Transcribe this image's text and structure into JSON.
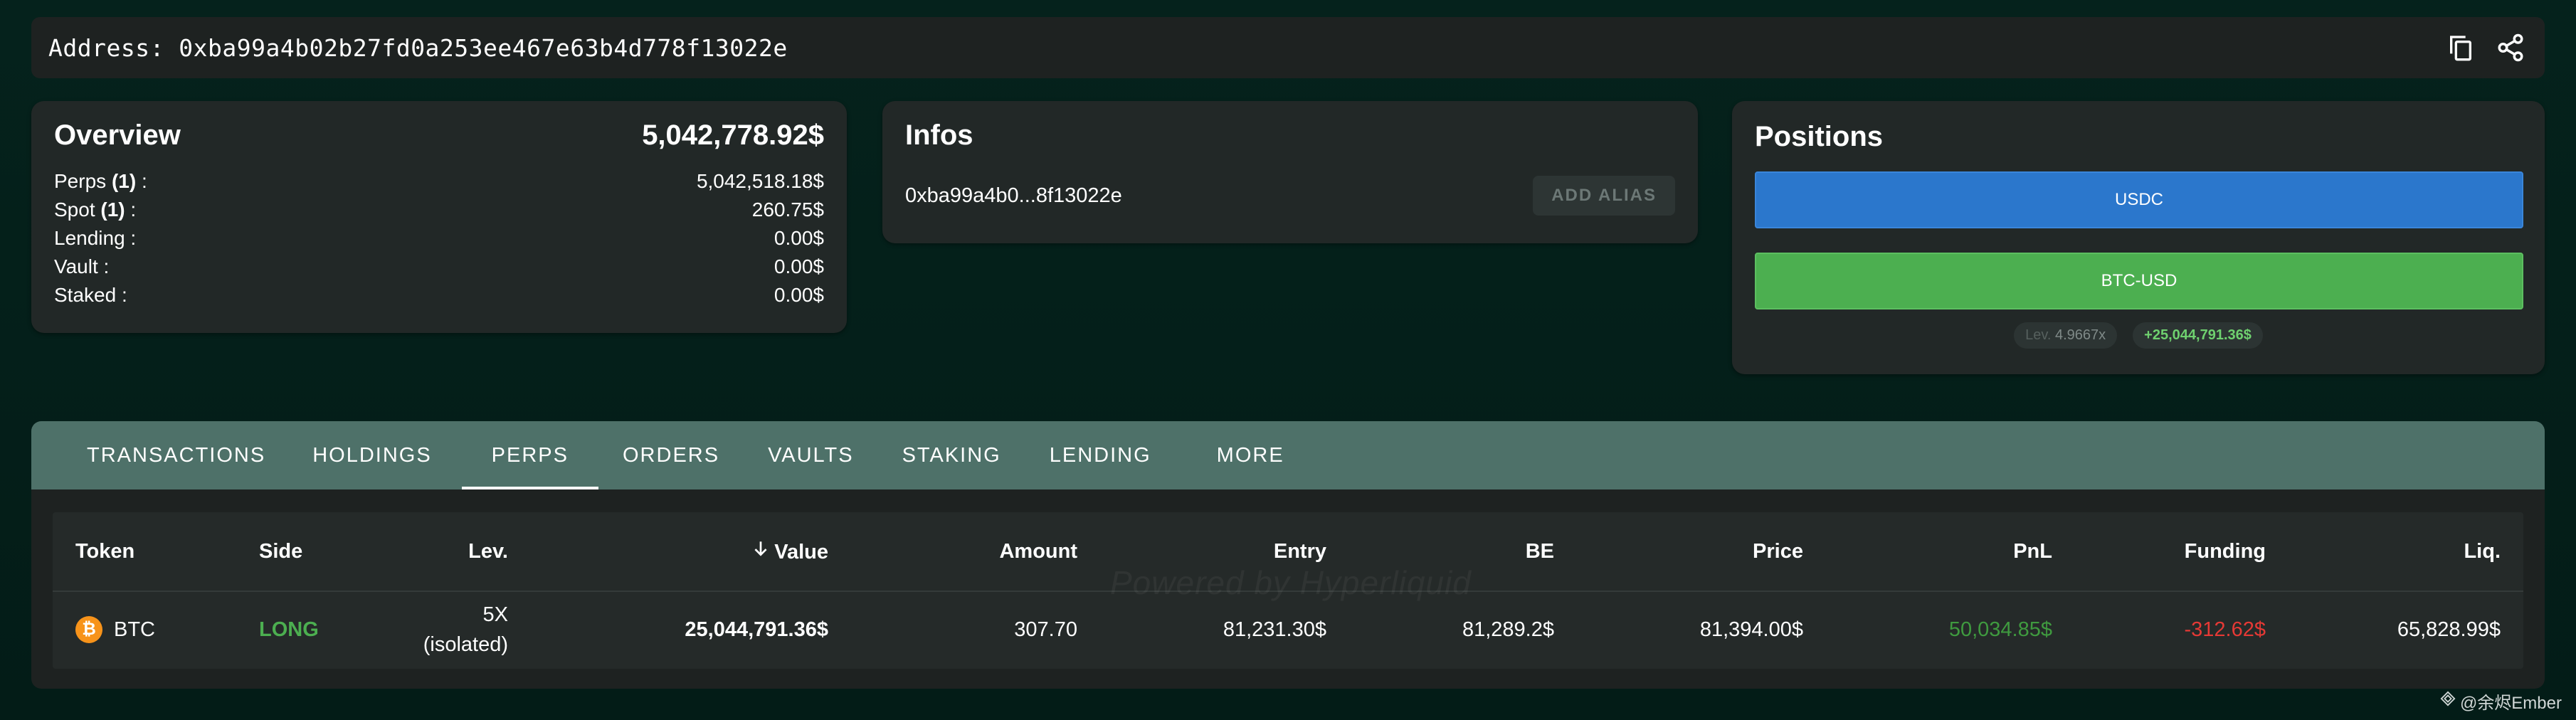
{
  "address_bar": {
    "label": "Address: 0xba99a4b02b27fd0a253ee467e63b4d778f13022e",
    "icons": [
      "copy-icon",
      "share-icon"
    ]
  },
  "overview": {
    "title": "Overview",
    "total": "5,042,778.92$",
    "rows": [
      {
        "label": "Perps",
        "count": "(1)",
        "suffix": " :",
        "value": "5,042,518.18$"
      },
      {
        "label": "Spot",
        "count": "(1)",
        "suffix": " :",
        "value": "260.75$"
      },
      {
        "label": "Lending :",
        "count": "",
        "suffix": "",
        "value": "0.00$"
      },
      {
        "label": "Vault :",
        "count": "",
        "suffix": "",
        "value": "0.00$"
      },
      {
        "label": "Staked :",
        "count": "",
        "suffix": "",
        "value": "0.00$"
      }
    ]
  },
  "infos": {
    "title": "Infos",
    "short_address": "0xba99a4b0...8f13022e",
    "alias_button": "ADD ALIAS"
  },
  "positions": {
    "title": "Positions",
    "usdc_label": "USDC",
    "btc_label": "BTC-USD",
    "lev_label": "Lev.",
    "lev_value": "4.9667x",
    "pnl_chip": "+25,044,791.36$"
  },
  "tabs": [
    "TRANSACTIONS",
    "HOLDINGS",
    "PERPS",
    "ORDERS",
    "VAULTS",
    "STAKING",
    "LENDING",
    "MORE"
  ],
  "active_tab": "PERPS",
  "table": {
    "headers": {
      "token": "Token",
      "side": "Side",
      "lev": "Lev.",
      "value": "Value",
      "amount": "Amount",
      "entry": "Entry",
      "be": "BE",
      "price": "Price",
      "pnl": "PnL",
      "funding": "Funding",
      "liq": "Liq."
    },
    "rows": [
      {
        "token": "BTC",
        "token_icon": "₿",
        "side": "LONG",
        "lev_line1": "5X",
        "lev_line2": "(isolated)",
        "value": "25,044,791.36$",
        "amount": "307.70",
        "entry": "81,231.30$",
        "be": "81,289.2$",
        "price": "81,394.00$",
        "pnl": "50,034.85$",
        "funding": "-312.62$",
        "liq": "65,828.99$"
      }
    ]
  },
  "watermark": "Powered by Hyperliquid",
  "credit": "@余烬Ember",
  "colors": {
    "background": "#04211b",
    "card": "#222827",
    "tab_bar": "#4e7169",
    "usdc": "#2b77cc",
    "btc": "#4caf50",
    "long": "#4caf50",
    "negative": "#e53935"
  }
}
